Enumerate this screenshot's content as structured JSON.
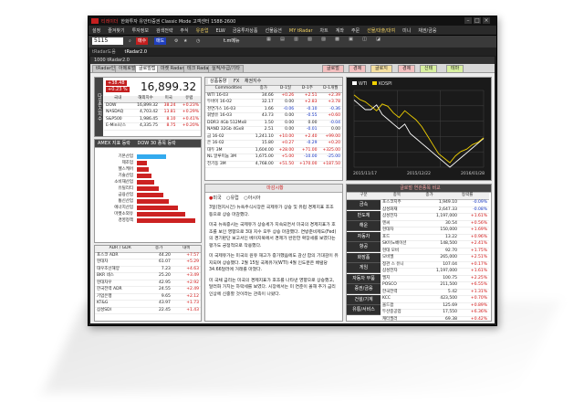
{
  "window": {
    "title": "한화투자 유안타증권 Classic Mode 고객센터 1588-2600",
    "brand": "티레이더"
  },
  "menu": [
    "설정",
    "즐겨찾기",
    "투자정보",
    "검색전략",
    "주식",
    "유관업",
    "ELW",
    "금융투자상품",
    "선물옵션",
    "MY tRadar",
    "차트",
    "계좌",
    "주문",
    "선물/대출/대여",
    "미니",
    "채권/금융"
  ],
  "toolbar": {
    "code": "5115",
    "buy_label": "매수",
    "sell_label": "매도",
    "menu_label": "t.m메뉴"
  },
  "subtab": [
    "tRadar도움",
    "tRadar2.0"
  ],
  "inner_title": "1000 tRadar2.0",
  "tabs": [
    "tRadar인터",
    "아메로벌",
    "글로벌랩",
    "마켓 Radar",
    "테크 Radar",
    "실적/수급/기타"
  ],
  "right_tabs": [
    "글로벌",
    "경제",
    "글로지",
    "경제",
    "신테",
    "테마"
  ],
  "index_panel": {
    "title": "다우존스지수",
    "change": "+38.48",
    "pct": "+0.23 %",
    "value": "16,899.32",
    "headers": [
      "국내",
      "해외지수",
      "미국",
      "유럽"
    ],
    "rows": [
      [
        "DOW",
        "16,899.32",
        "38.24",
        "+0.23%"
      ],
      [
        "NASDAQ",
        "4,703.42",
        "13.81",
        "+0.29%"
      ],
      [
        "S&P500",
        "1,986.45",
        "8.10",
        "+0.41%"
      ],
      [
        "E-Mini나스",
        "4,335.75",
        "8.75",
        "+0.20%"
      ]
    ]
  },
  "sector_panel": {
    "tabs": [
      "AMEX 지표 등락",
      "DOW 30 종목 등락"
    ],
    "items": [
      {
        "label": "기본산업",
        "value": 12,
        "color": "#33aaee"
      },
      {
        "label": "제조업",
        "value": 4,
        "color": "#c22"
      },
      {
        "label": "헬스케어",
        "value": 5,
        "color": "#c22"
      },
      {
        "label": "기술산업",
        "value": 6,
        "color": "#c22"
      },
      {
        "label": "소비재산업",
        "value": 7,
        "color": "#c22"
      },
      {
        "label": "유틸리티",
        "value": 9,
        "color": "#c22"
      },
      {
        "label": "금융산업",
        "value": 11,
        "color": "#c22"
      },
      {
        "label": "통신산업",
        "value": 13,
        "color": "#c22"
      },
      {
        "label": "에너지산업",
        "value": 17,
        "color": "#c22"
      },
      {
        "label": "마켓소외유",
        "value": 20,
        "color": "#c22"
      },
      {
        "label": "경영정책",
        "value": 24,
        "color": "#c22"
      }
    ]
  },
  "adr_panel": {
    "headers": [
      "ADR / GDR",
      "종가",
      "대비"
    ],
    "rows": [
      [
        "포스코 ADR",
        "44.20",
        "+7.57"
      ],
      [
        "현대차",
        "61.07",
        "+5.29"
      ],
      [
        "대우조선해양",
        "7.23",
        "+4.63"
      ],
      [
        "BKR 네스",
        "25.20",
        "+3.49"
      ],
      [
        "현대차우",
        "42.95",
        "+2.92"
      ],
      [
        "한국전력 ADR",
        "24.55",
        "+2.49"
      ],
      [
        "기업은행",
        "9.65",
        "+2.12"
      ],
      [
        "KT&G",
        "43.97",
        "+1.73"
      ],
      [
        "삼성SDI",
        "22.45",
        "+1.43"
      ]
    ]
  },
  "commodity_panel": {
    "tabs": [
      "상품동향",
      "FX",
      "채권지수"
    ],
    "headers": [
      "Commodities",
      "종가",
      "D-1일",
      "D-1주",
      "D-1개월"
    ],
    "rows": [
      [
        "WTI 16-03",
        "34.66",
        "+0.26",
        "+2.51",
        "+2.39"
      ],
      [
        "두바이 16-02",
        "32.17",
        "0.00",
        "+2.83",
        "+3.78"
      ],
      [
        "천연가스 16-03",
        "1.66",
        "-0.06",
        "-0.10",
        "-0.36"
      ],
      [
        "휘발유 16-03",
        "43.73",
        "0.00",
        "-0.55",
        "+0.60"
      ],
      [
        "DDR3 4Gb 512Mx8",
        "1.50",
        "0.00",
        "0.00",
        "-0.04"
      ],
      [
        "NAND 32Gb 4Gx8",
        "2.51",
        "0.00",
        "-0.01",
        "0.00"
      ],
      [
        "금 16-02",
        "1,241.10",
        "+10.00",
        "+2.40",
        "+99.00"
      ],
      [
        "은 16-02",
        "15.80",
        "+0.27",
        "-0.29",
        "+0.20"
      ],
      [
        "대두 3M",
        "1,604.00",
        "+28.00",
        "+71.00",
        "+325.00"
      ],
      [
        "NL 알루미늄 3M",
        "1,675.00",
        "+5.00",
        "-10.00",
        "-25.00"
      ],
      [
        "전기동 3M",
        "4,768.00",
        "+51.50",
        "+170.00",
        "+187.50"
      ]
    ]
  },
  "chart_data": {
    "type": "line",
    "legend": [
      "WTI",
      "KOSPI"
    ],
    "x_labels": [
      "2015/11/17",
      "2015/12/22",
      "2016/01/28"
    ],
    "series": [
      {
        "name": "WTI",
        "color": "#ffffff",
        "values": [
          42,
          41,
          40,
          40,
          41,
          39,
          38,
          37,
          36,
          37,
          35,
          34,
          33,
          32,
          31,
          30,
          29,
          28,
          29,
          30,
          31,
          32,
          33,
          34
        ]
      },
      {
        "name": "KOSPI",
        "color": "#f0d000",
        "values": [
          2010,
          2000,
          1995,
          1985,
          1975,
          1990,
          1985,
          1970,
          1960,
          1975,
          1965,
          1955,
          1940,
          1920,
          1900,
          1880,
          1870,
          1860,
          1875,
          1885,
          1890,
          1900,
          1905,
          1915
        ]
      }
    ],
    "ylim": [
      28,
      44
    ],
    "y2lim": [
      1850,
      2020
    ]
  },
  "news_panel": {
    "title": "마감시황",
    "tabs": [
      "미국",
      "유럽",
      "아시아"
    ],
    "paragraphs": [
      "3일(현지시간) 뉴욕주식시장은 국제유가 상승 및 유럽 경제지표 호조 등으로 상승 마감했다.",
      "미국 뉴욕증시는 국제유가 상승세가 지속되면서 미국의 경제지표가 호조를 보인 영향으로 3대 지수 모두 상승 마감했다. 연방준비제도(Fed)의 경기판단 보고서인 베이지북에서 경제가 완만한 확장세를 보였다는 평가도 긍정적으로 작용했다.",
      "미 국제유가는 미국의 원유 재고가 증가했음에도 감산 합의 기대감이 유지되며 상승했다. 2월 15일 국제유가(WTI) 4월 인도분은 배럴당 34.66달러에 거래를 마쳤다.",
      "미 국채 금리는 미국의 경제지표가 호조를 나타낸 영향으로 상승했고, 달러화 가치는 하락세를 보였다. 시장에서는 미 연준이 올해 추가 금리 인상에 신중할 것이라는 관측이 나왔다."
    ]
  },
  "global_panel": {
    "title": "글로벌 연관종목 비교",
    "headers": [
      "구분",
      "종목",
      "종가",
      "등락률"
    ],
    "buttons": [
      "금속",
      "반도체",
      "해운",
      "자동차",
      "항공",
      "화장품",
      "게임",
      "자동차 부품",
      "증권/금융",
      "건설/기계",
      "유통/서비스"
    ],
    "rows": [
      [
        "포스코지주",
        "1,949.10",
        "-0.09%"
      ],
      [
        "삼성화재",
        "2,647.33",
        "-0.08%"
      ],
      [
        "삼성전자",
        "1,197,000",
        "+1.61%"
      ],
      [
        "엔씨",
        "30.54",
        "+0.56%"
      ],
      [
        "현대차",
        "150,000",
        "+1.69%"
      ],
      [
        "포드",
        "13.22",
        "+0.96%"
      ],
      [
        "SK이노베이션",
        "148,500",
        "+2.41%"
      ],
      [
        "현대 모비",
        "92.70",
        "+1.75%"
      ],
      [
        "모비엘",
        "265,000",
        "+2.51%"
      ],
      [
        "정관 스 유니",
        "107.04",
        "+0.17%"
      ],
      [
        "삼성전자",
        "1,197,000",
        "+1.61%"
      ],
      [
        "엘지",
        "100.75",
        "+2.25%"
      ],
      [
        "POSCO",
        "211,500",
        "+6.55%"
      ],
      [
        "한국전력",
        "5.42",
        "+1.31%"
      ],
      [
        "KCC",
        "423,500",
        "+0.70%"
      ],
      [
        "올드팜",
        "125.69",
        "+0.89%"
      ],
      [
        "두산중공업",
        "17,550",
        "+6.36%"
      ],
      [
        "캐터필러",
        "69.38",
        "+0.42%"
      ]
    ]
  }
}
